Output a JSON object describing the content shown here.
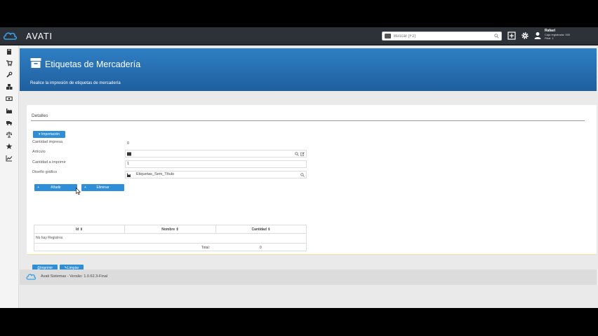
{
  "app": {
    "brand": "AVATI"
  },
  "search": {
    "placeholder": "Buscar (F2)"
  },
  "user": {
    "name": "Rafael",
    "line1": "Caja registrada: 000",
    "line2": "Filial: 1"
  },
  "page": {
    "title": "Etiquetas de Mercadería",
    "subtitle": "Realice la impresión de etiquetas de mercadería"
  },
  "panel": {
    "title": "Detalles",
    "import_label": "Importación",
    "fields": {
      "cantidad_impresa_label": "Cantidad impresa",
      "cantidad_impresa_value": "0",
      "articulo_label": "Artículo",
      "articulo_value": "",
      "cantidad_imprimir_label": "Cantidad a imprimir",
      "cantidad_imprimir_value": "1",
      "diseno_label": "Diseño gráfico",
      "diseno_value": "Etiquetas_Sem_Título"
    },
    "add_label": "Añadir",
    "remove_label": "Eliminar",
    "table": {
      "columns": [
        "Id",
        "Nombre",
        "Cantidad"
      ],
      "empty": "No hay Registros",
      "total_label": "Total:",
      "total_value": "0"
    },
    "print_label": "Imprimir",
    "clear_label": "Limpiar"
  },
  "footer": {
    "text": "Avati Sistemas - Versão: 1.0.62.3-Final"
  },
  "colors": {
    "accent": "#2e8fd8",
    "topbar": "#2d3238",
    "header": "#2a72b5"
  },
  "icons": {
    "sidebar": [
      "book-icon",
      "cart-icon",
      "wrench-icon",
      "boxes-icon",
      "money-icon",
      "factory-icon",
      "truck-icon",
      "scale-icon",
      "star-icon",
      "chart-icon"
    ],
    "topbar": [
      "plus-square-icon",
      "gear-icon",
      "user-icon"
    ]
  }
}
